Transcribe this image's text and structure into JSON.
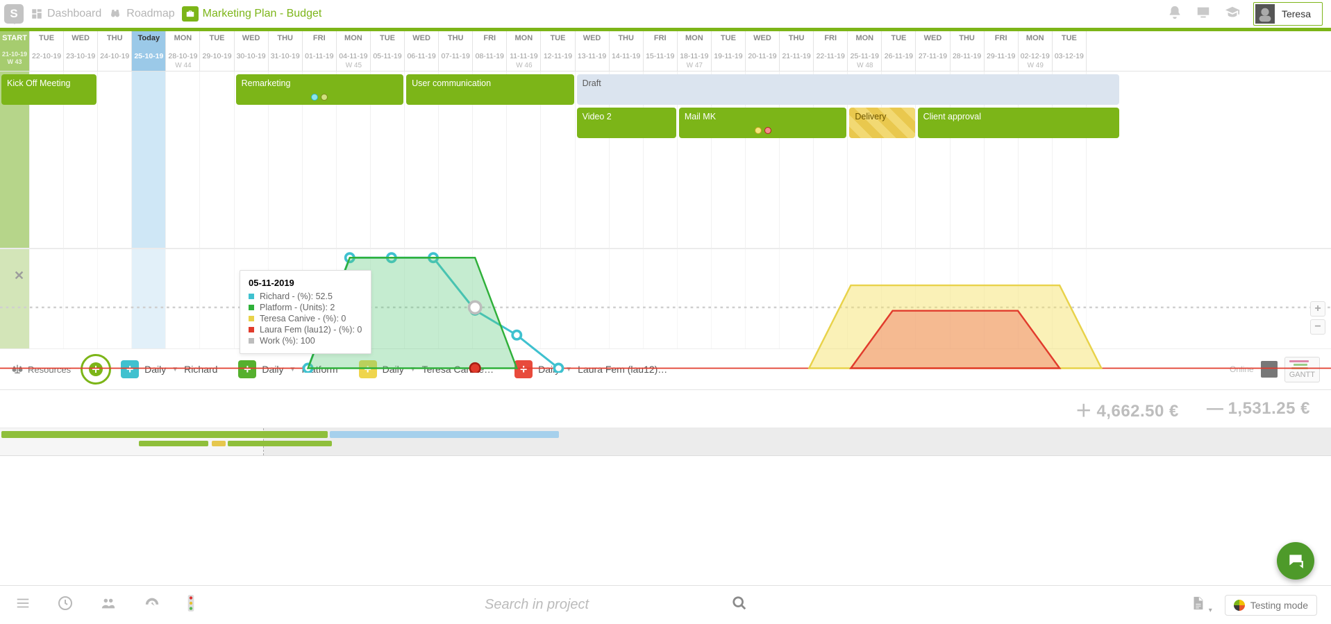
{
  "nav": {
    "dashboard": "Dashboard",
    "roadmap": "Roadmap",
    "project": "Marketing Plan - Budget"
  },
  "user": {
    "name": "Teresa",
    "online_label": "Online"
  },
  "timeline": {
    "start_label": "START",
    "start_date": "21-10-19",
    "start_week": "W 43",
    "today_label": "Today",
    "columns": [
      {
        "dow": "TUE",
        "date": "22-10-19"
      },
      {
        "dow": "WED",
        "date": "23-10-19"
      },
      {
        "dow": "THU",
        "date": "24-10-19"
      },
      {
        "dow": "Today",
        "date": "25-10-19",
        "today": true
      },
      {
        "dow": "MON",
        "date": "28-10-19",
        "week": "W 44"
      },
      {
        "dow": "TUE",
        "date": "29-10-19"
      },
      {
        "dow": "WED",
        "date": "30-10-19"
      },
      {
        "dow": "THU",
        "date": "31-10-19"
      },
      {
        "dow": "FRI",
        "date": "01-11-19"
      },
      {
        "dow": "MON",
        "date": "04-11-19",
        "week": "W 45"
      },
      {
        "dow": "TUE",
        "date": "05-11-19"
      },
      {
        "dow": "WED",
        "date": "06-11-19"
      },
      {
        "dow": "THU",
        "date": "07-11-19"
      },
      {
        "dow": "FRI",
        "date": "08-11-19"
      },
      {
        "dow": "MON",
        "date": "11-11-19",
        "week": "W 46"
      },
      {
        "dow": "TUE",
        "date": "12-11-19"
      },
      {
        "dow": "WED",
        "date": "13-11-19"
      },
      {
        "dow": "THU",
        "date": "14-11-19"
      },
      {
        "dow": "FRI",
        "date": "15-11-19"
      },
      {
        "dow": "MON",
        "date": "18-11-19",
        "week": "W 47"
      },
      {
        "dow": "TUE",
        "date": "19-11-19"
      },
      {
        "dow": "WED",
        "date": "20-11-19"
      },
      {
        "dow": "THU",
        "date": "21-11-19"
      },
      {
        "dow": "FRI",
        "date": "22-11-19"
      },
      {
        "dow": "MON",
        "date": "25-11-19",
        "week": "W 48"
      },
      {
        "dow": "TUE",
        "date": "26-11-19"
      },
      {
        "dow": "WED",
        "date": "27-11-19"
      },
      {
        "dow": "THU",
        "date": "28-11-19"
      },
      {
        "dow": "FRI",
        "date": "29-11-19"
      },
      {
        "dow": "MON",
        "date": "02-12-19",
        "week": "W 49"
      },
      {
        "dow": "TUE",
        "date": "03-12-19"
      }
    ]
  },
  "tasks": [
    {
      "name": "Kick Off Meeting",
      "row": 0,
      "start": -1,
      "span": 2,
      "style": "green"
    },
    {
      "name": "Remarketing",
      "row": 0,
      "start": 6,
      "span": 5,
      "style": "green",
      "dots": [
        "cyan",
        "olive"
      ]
    },
    {
      "name": "User communication",
      "row": 0,
      "start": 11,
      "span": 5,
      "style": "green"
    },
    {
      "name": "Draft",
      "row": 0,
      "start": 16,
      "span": 16,
      "style": "light"
    },
    {
      "name": "Video 2",
      "row": 1,
      "start": 16,
      "span": 3,
      "style": "green"
    },
    {
      "name": "Mail MK",
      "row": 1,
      "start": 19,
      "span": 5,
      "style": "green",
      "dots": [
        "yellow",
        "red"
      ]
    },
    {
      "name": "Delivery",
      "row": 1,
      "start": 24,
      "span": 2,
      "style": "yellow"
    },
    {
      "name": "Client approval",
      "row": 1,
      "start": 26,
      "span": 6,
      "style": "green"
    }
  ],
  "tooltip": {
    "date": "05-11-2019",
    "rows": [
      {
        "color": "#3fc1cf",
        "text": "Richard - (%): 52.5"
      },
      {
        "color": "#2fb03a",
        "text": "Platform - (Units): 2"
      },
      {
        "color": "#e8d24a",
        "text": "Teresa Canive - (%): 0"
      },
      {
        "color": "#e13b2c",
        "text": "Laura Fem (lau12) - (%): 0"
      },
      {
        "color": "#bdbdbd",
        "text": "Work (%): 100"
      }
    ]
  },
  "resources": {
    "lead_label": "Resources",
    "freq_label": "Daily",
    "items": [
      {
        "color": "cyan",
        "name": "Richard"
      },
      {
        "color": "green",
        "name": "Platform"
      },
      {
        "color": "yellow",
        "name": "Teresa Canive…"
      },
      {
        "color": "red",
        "name": "Laura Fem (lau12)…"
      }
    ],
    "gantt_label": "GANTT"
  },
  "totals": {
    "positive": "4,662.50 €",
    "negative": "1,531.25 €"
  },
  "footer": {
    "search_placeholder": "Search in project",
    "testing_label": "Testing mode"
  },
  "chart_data": {
    "type": "line",
    "x_index_meaning": "day column index matching timeline.columns",
    "ylim": [
      0,
      100
    ],
    "work_threshold": 100,
    "series": [
      {
        "name": "Richard",
        "color": "#3fc1cf",
        "points": [
          {
            "x": 6,
            "y": 0
          },
          {
            "x": 7,
            "y": 100
          },
          {
            "x": 8,
            "y": 100
          },
          {
            "x": 9,
            "y": 100
          },
          {
            "x": 10,
            "y": 52.5
          },
          {
            "x": 11,
            "y": 30
          },
          {
            "x": 12,
            "y": 0
          }
        ]
      },
      {
        "name": "Platform",
        "color": "#2fb03a",
        "units": true,
        "fill": "rgba(88,200,120,.35)",
        "points": [
          {
            "x": 6,
            "y": 0
          },
          {
            "x": 7,
            "y": 100
          },
          {
            "x": 8,
            "y": 100
          },
          {
            "x": 9,
            "y": 100
          },
          {
            "x": 10,
            "y": 100
          },
          {
            "x": 11,
            "y": 0
          }
        ]
      },
      {
        "name": "Teresa Canive",
        "color": "#e8d24a",
        "fill": "rgba(245,224,95,.45)",
        "points": [
          {
            "x": 18,
            "y": 0
          },
          {
            "x": 19,
            "y": 75
          },
          {
            "x": 20,
            "y": 75
          },
          {
            "x": 21,
            "y": 75
          },
          {
            "x": 22,
            "y": 75
          },
          {
            "x": 23,
            "y": 75
          },
          {
            "x": 24,
            "y": 75
          },
          {
            "x": 25,
            "y": 0
          }
        ]
      },
      {
        "name": "Laura Fem (lau12)",
        "color": "#e13b2c",
        "fill": "rgba(240,120,100,.45)",
        "points": [
          {
            "x": 19,
            "y": 0
          },
          {
            "x": 20,
            "y": 52
          },
          {
            "x": 21,
            "y": 52
          },
          {
            "x": 22,
            "y": 52
          },
          {
            "x": 23,
            "y": 52
          },
          {
            "x": 24,
            "y": 0
          }
        ]
      },
      {
        "name": "Work",
        "color": "#bdbdbd",
        "dashed": true,
        "points": []
      }
    ]
  }
}
